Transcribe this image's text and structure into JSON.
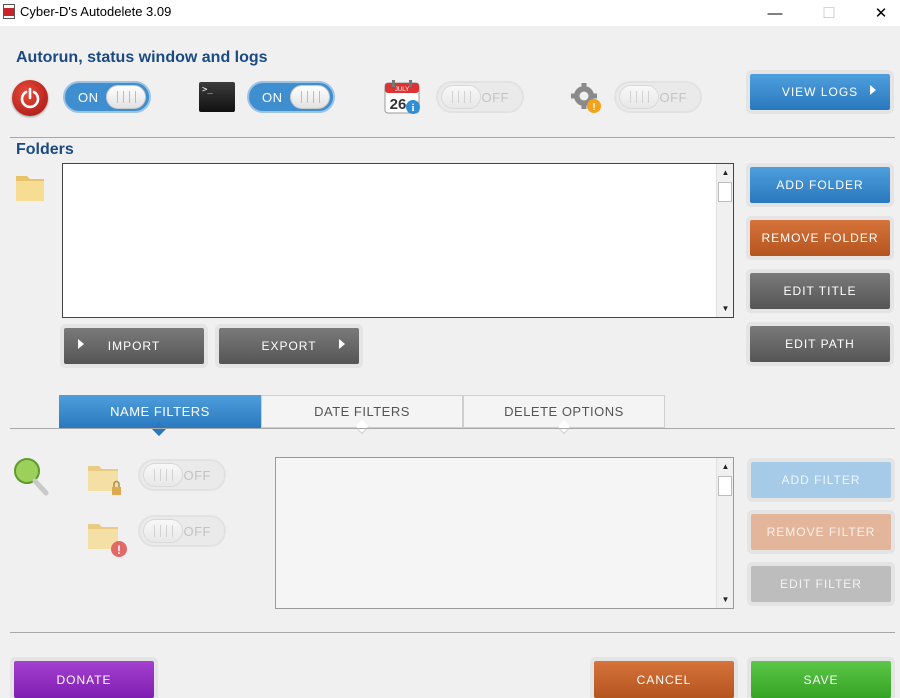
{
  "window": {
    "title": "Cyber-D's Autodelete 3.09",
    "minimize": "—",
    "maximize": "☐",
    "close": "✕"
  },
  "autorun": {
    "heading": "Autorun, status window and logs",
    "toggles": [
      {
        "icon": "power-icon",
        "state": "ON"
      },
      {
        "icon": "terminal-icon",
        "state": "ON"
      },
      {
        "icon": "calendar-icon",
        "state": "OFF"
      },
      {
        "icon": "gear-warning-icon",
        "state": "OFF"
      }
    ],
    "calendar_month": "JULY",
    "calendar_day": "26",
    "terminal_prompt": ">_",
    "view_logs": "VIEW LOGS"
  },
  "folders": {
    "heading": "Folders",
    "items": [],
    "buttons": {
      "add": "ADD FOLDER",
      "remove": "REMOVE FOLDER",
      "edit_title": "EDIT TITLE",
      "edit_path": "EDIT PATH"
    },
    "import": "IMPORT",
    "export": "EXPORT"
  },
  "tabs": [
    {
      "label": "NAME FILTERS",
      "active": true
    },
    {
      "label": "DATE FILTERS",
      "active": false
    },
    {
      "label": "DELETE OPTIONS",
      "active": false
    }
  ],
  "filters": {
    "toggle_lock": "OFF",
    "toggle_warning": "OFF",
    "items": [],
    "buttons": {
      "add": "ADD FILTER",
      "remove": "REMOVE FILTER",
      "edit": "EDIT FILTER"
    }
  },
  "footer": {
    "donate": "DONATE",
    "cancel": "CANCEL",
    "save": "SAVE"
  },
  "colors": {
    "accent_blue": "#2a78be",
    "heading_blue": "#1b4a83",
    "orange": "#b4541f",
    "purple": "#7f1fb2",
    "green": "#35a325"
  }
}
